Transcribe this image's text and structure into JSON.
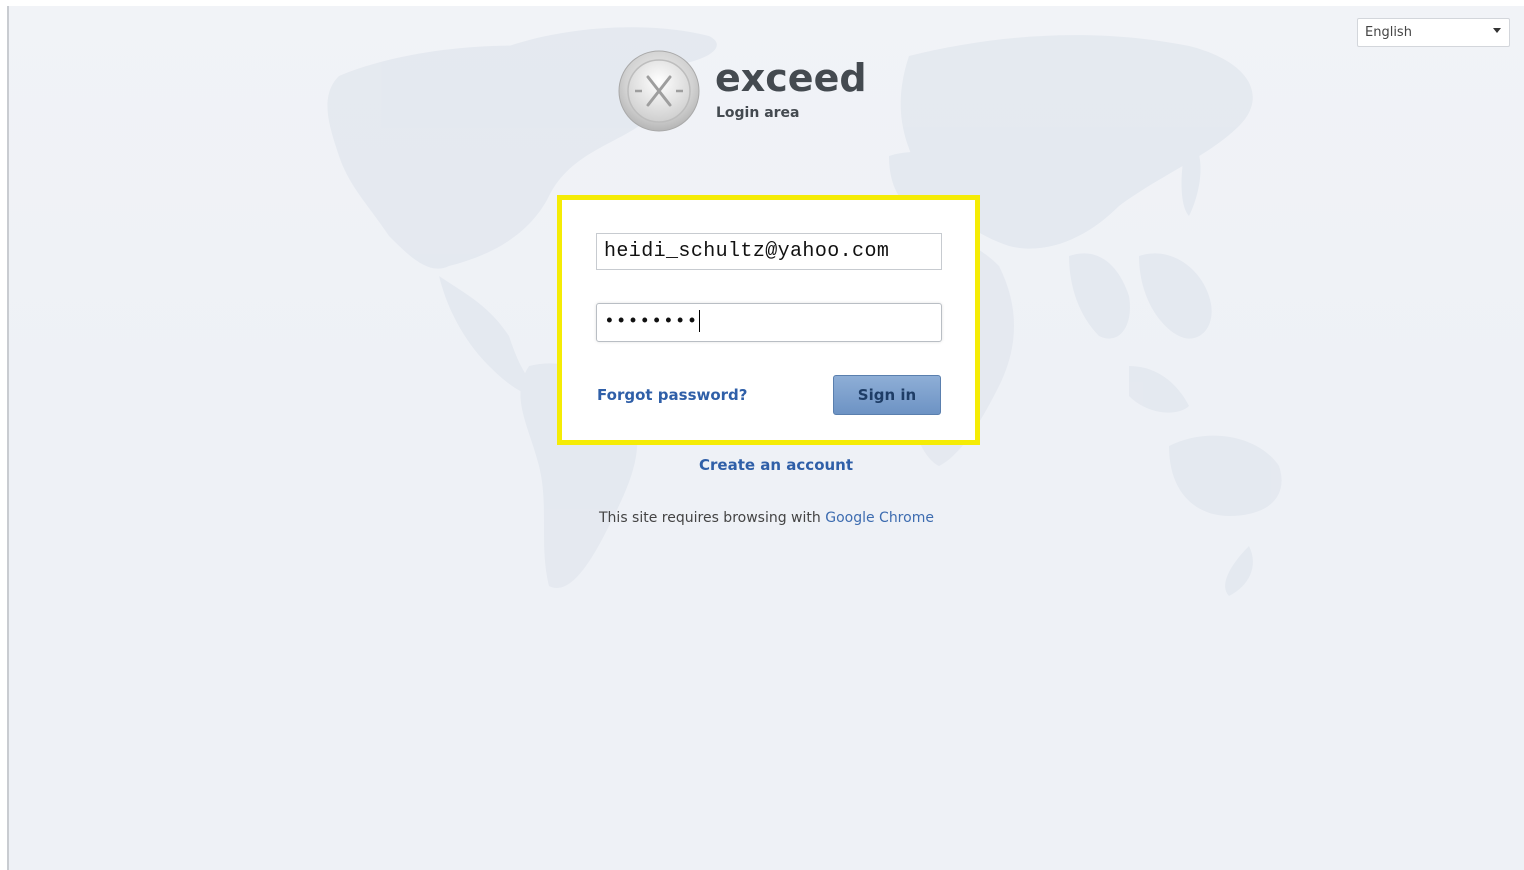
{
  "language_selector": {
    "selected": "English"
  },
  "brand": {
    "name": "exceed",
    "subtitle": "Login area",
    "logo_letter": "X"
  },
  "login_form": {
    "email_value": "heidi_schultz@yahoo.com",
    "password_value": "••••••••",
    "forgot_password_label": "Forgot password?",
    "sign_in_label": "Sign in",
    "highlight_color": "#f5ec05"
  },
  "create_account_label": "Create an account",
  "browser_note": {
    "text": "This site requires browsing with",
    "link_label": "Google Chrome"
  },
  "colors": {
    "link": "#2f5fa8",
    "button": "#7a9fcf",
    "background": "#eef1f6"
  }
}
